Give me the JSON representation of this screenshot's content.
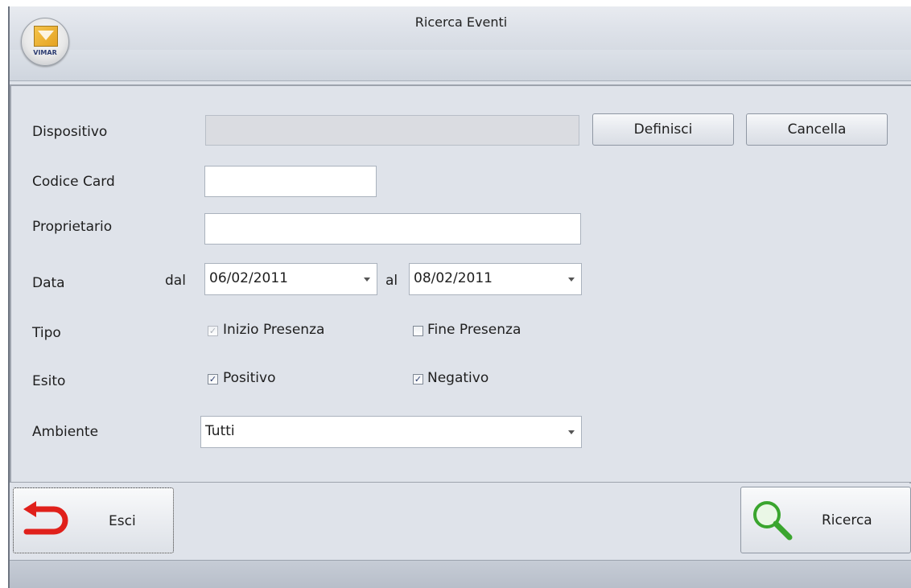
{
  "window": {
    "title": "Ricerca Eventi",
    "logo_text": "VIMAR"
  },
  "form": {
    "dispositivo": {
      "label": "Dispositivo",
      "value": "",
      "define_button": "Definisci",
      "clear_button": "Cancella"
    },
    "codice_card": {
      "label": "Codice Card",
      "value": ""
    },
    "proprietario": {
      "label": "Proprietario",
      "value": ""
    },
    "data": {
      "label": "Data",
      "from_label": "dal",
      "from_value": "06/02/2011",
      "to_label": "al",
      "to_value": "08/02/2011"
    },
    "tipo": {
      "label": "Tipo",
      "inizio": {
        "label": "Inizio Presenza",
        "checked": true,
        "enabled": false
      },
      "fine": {
        "label": "Fine Presenza",
        "checked": false,
        "enabled": true
      }
    },
    "esito": {
      "label": "Esito",
      "positivo": {
        "label": "Positivo",
        "checked": true
      },
      "negativo": {
        "label": "Negativo",
        "checked": true
      }
    },
    "ambiente": {
      "label": "Ambiente",
      "value": "Tutti"
    }
  },
  "footer": {
    "exit_button": "Esci",
    "search_button": "Ricerca"
  },
  "icons": {
    "exit": "return-arrow-icon",
    "search": "magnifier-icon",
    "exit_color": "#e0201b",
    "search_color": "#3aa52e"
  }
}
